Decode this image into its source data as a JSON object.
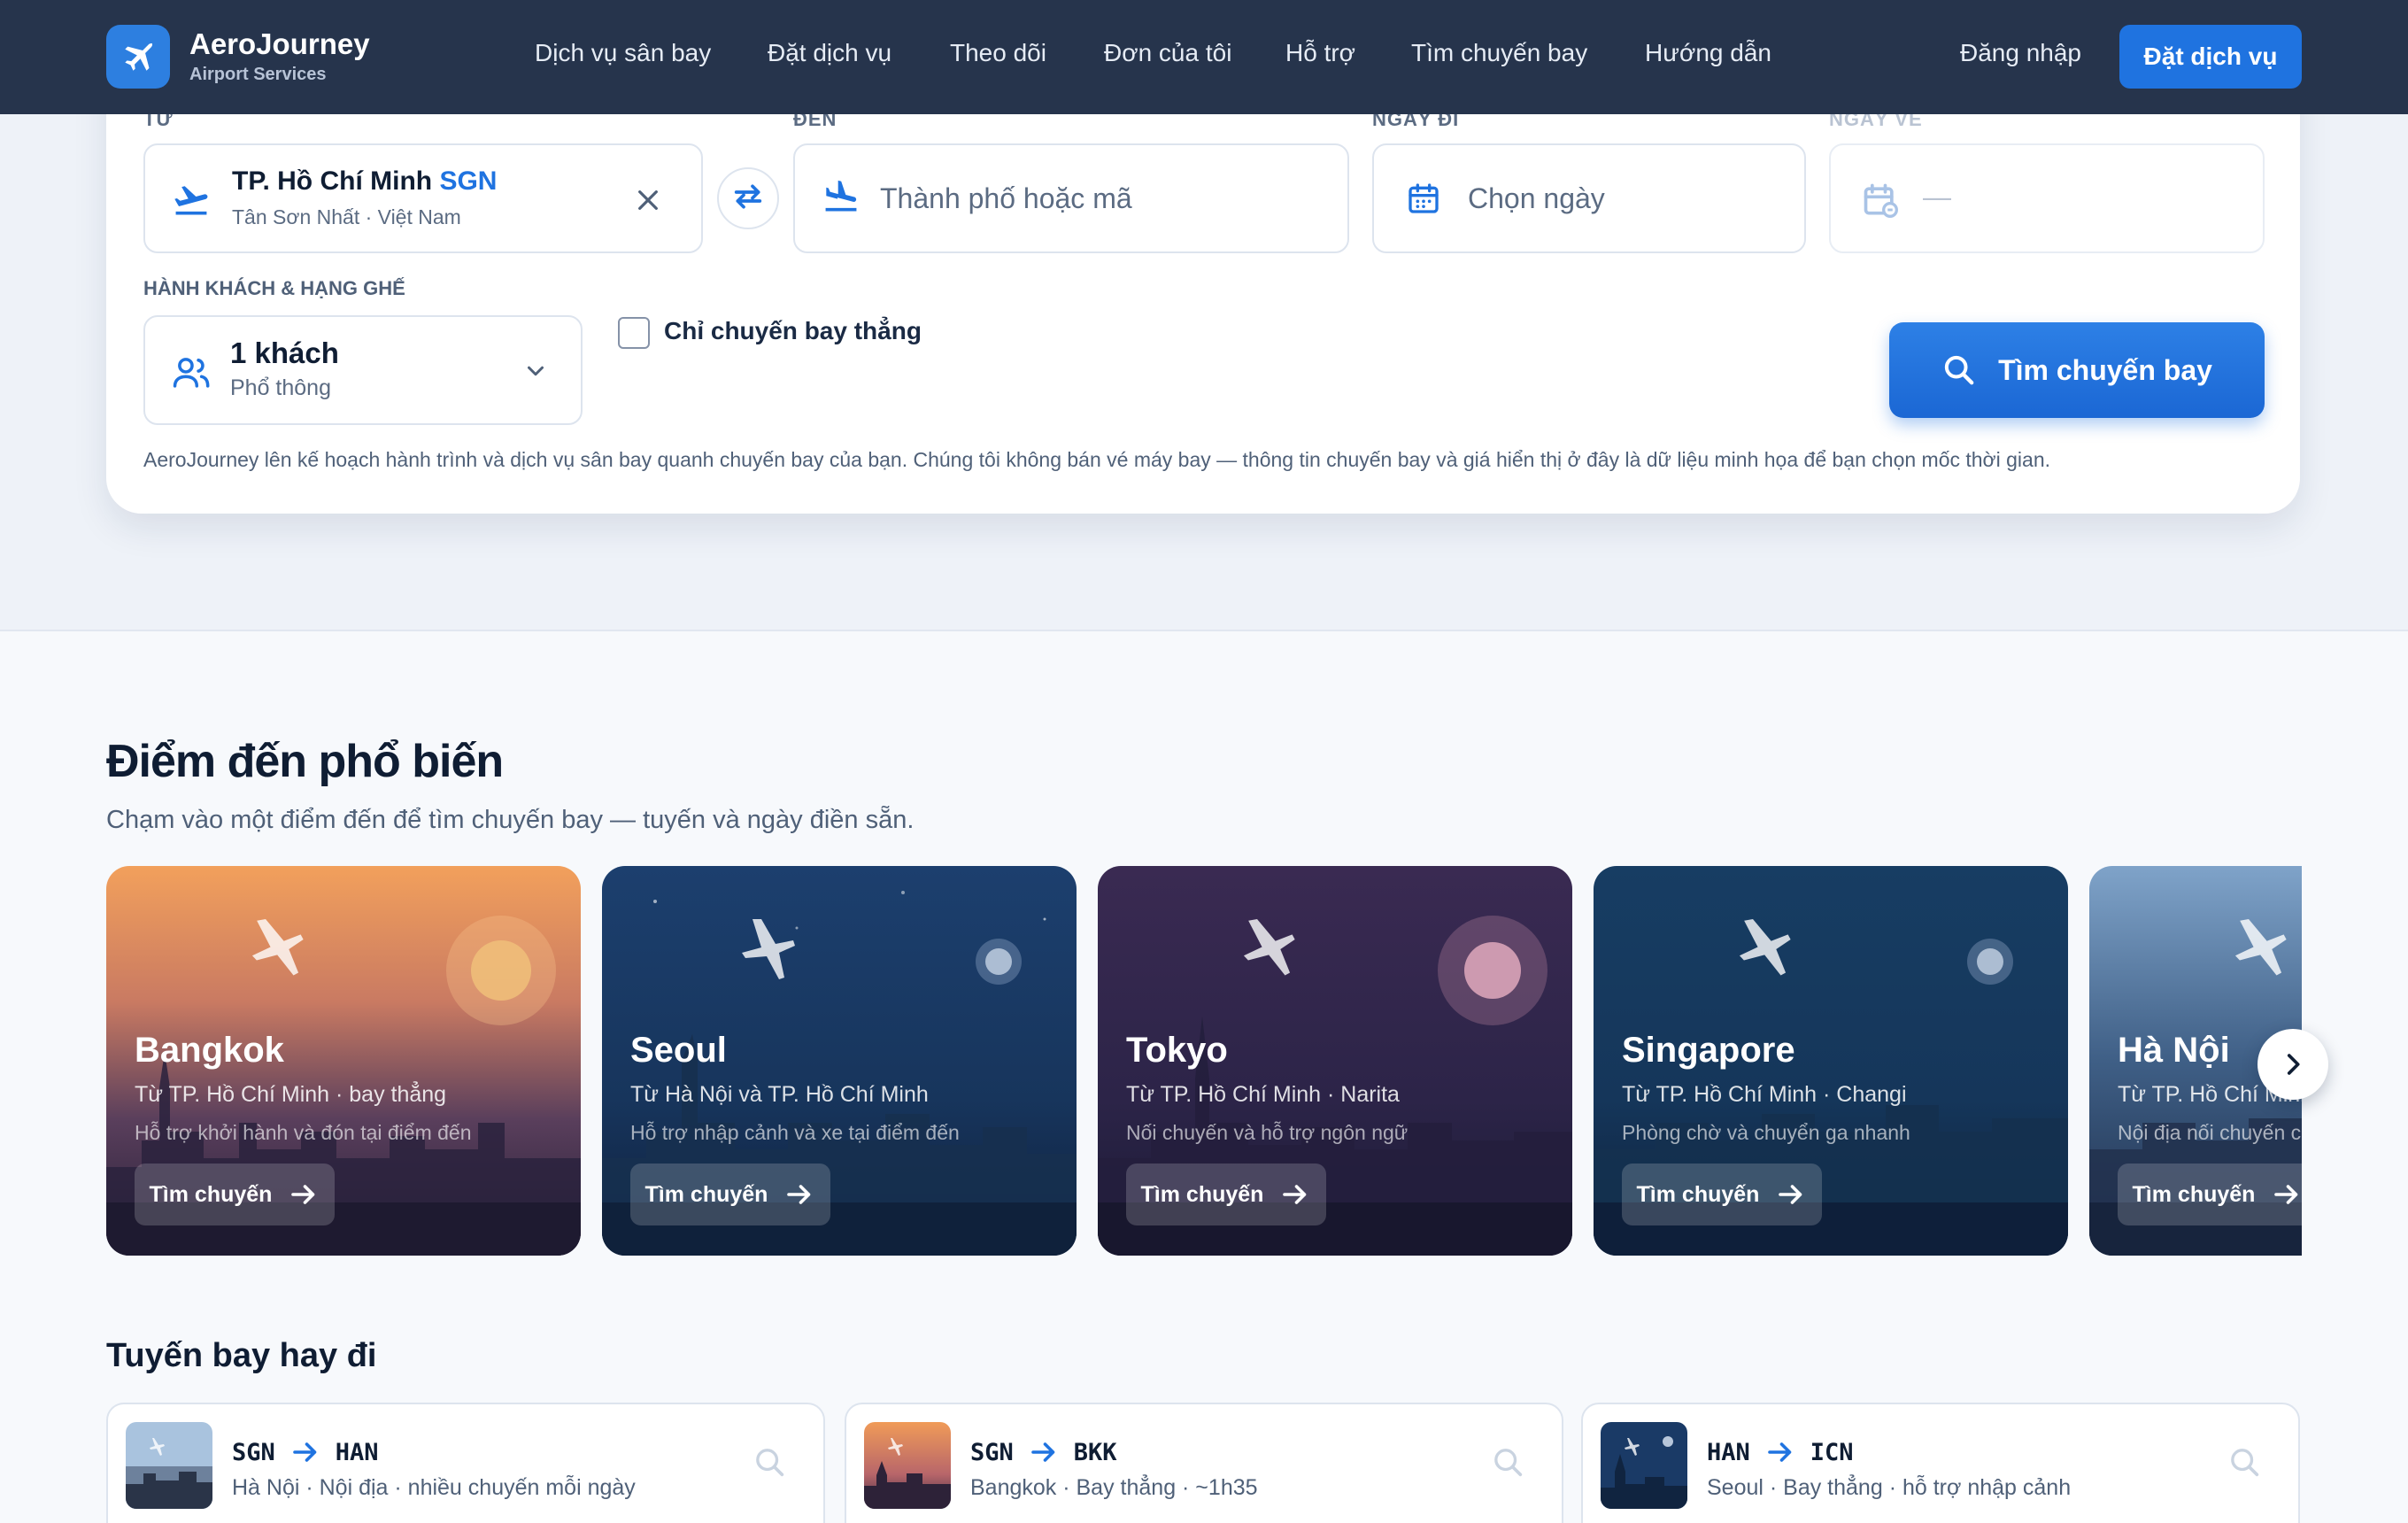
{
  "header": {
    "brand_name": "AeroJourney",
    "brand_sub": "Airport Services",
    "nav": [
      "Dịch vụ sân bay",
      "Đặt dịch vụ",
      "Theo dõi",
      "Đơn của tôi",
      "Hỗ trợ",
      "Tìm chuyến bay",
      "Hướng dẫn"
    ],
    "login": "Đăng nhập",
    "book_button": "Đặt dịch vụ"
  },
  "search": {
    "from_label": "TỪ",
    "from_city": "TP. Hồ Chí Minh",
    "from_code": "SGN",
    "from_sub": "Tân Sơn Nhất · Việt Nam",
    "to_label": "ĐẾN",
    "to_placeholder": "Thành phố hoặc mã",
    "depart_label": "NGÀY ĐI",
    "depart_placeholder": "Chọn ngày",
    "return_label": "NGÀY VỀ",
    "return_placeholder": "—",
    "passenger_label": "HÀNH KHÁCH & HẠNG GHẾ",
    "passenger_count": "1 khách",
    "cabin_class": "Phổ thông",
    "direct_only_label": "Chỉ chuyến bay thẳng",
    "direct_only_checked": false,
    "search_button": "Tìm chuyến bay",
    "disclaimer": "AeroJourney lên kế hoạch hành trình và dịch vụ sân bay quanh chuyến bay của bạn. Chúng tôi không bán vé máy bay — thông tin chuyến bay và giá hiển thị ở đây là dữ liệu minh họa để bạn chọn mốc thời gian."
  },
  "popular": {
    "title": "Điểm đến phổ biến",
    "subtitle": "Chạm vào một điểm đến để tìm chuyến bay — tuyến và ngày điền sẵn.",
    "button_label": "Tìm chuyến",
    "destinations": [
      {
        "name": "Bangkok",
        "route": "Từ TP. Hồ Chí Minh · bay thẳng",
        "desc": "Hỗ trợ khởi hành và đón tại điểm đến",
        "theme": "sunset"
      },
      {
        "name": "Seoul",
        "route": "Từ Hà Nội và TP. Hồ Chí Minh",
        "desc": "Hỗ trợ nhập cảnh và xe tại điểm đến",
        "theme": "night-blue"
      },
      {
        "name": "Tokyo",
        "route": "Từ TP. Hồ Chí Minh · Narita",
        "desc": "Nối chuyến và hỗ trợ ngôn ngữ",
        "theme": "night-purple"
      },
      {
        "name": "Singapore",
        "route": "Từ TP. Hồ Chí Minh · Changi",
        "desc": "Phòng chờ và chuyển ga nhanh",
        "theme": "night-teal"
      },
      {
        "name": "Hà Nội",
        "route": "Từ TP. Hồ Chí Minh",
        "desc": "Nội địa nối chuyến c",
        "theme": "dusk-blue"
      }
    ]
  },
  "routes": {
    "title": "Tuyến bay hay đi",
    "items": [
      {
        "from": "SGN",
        "to": "HAN",
        "sub": "Hà Nội · Nội địa · nhiều chuyến mỗi ngày",
        "theme": "day"
      },
      {
        "from": "SGN",
        "to": "BKK",
        "sub": "Bangkok · Bay thẳng · ~1h35",
        "theme": "sunset"
      },
      {
        "from": "HAN",
        "to": "ICN",
        "sub": "Seoul · Bay thẳng · hỗ trợ nhập cảnh",
        "theme": "night"
      }
    ]
  },
  "colors": {
    "header_bg": "#26344c",
    "accent": "#1f73e0",
    "text_dark": "#0f1d33",
    "text_muted": "#4f6078"
  },
  "icons": [
    "plane-logo-icon",
    "takeoff-icon",
    "clear-icon",
    "swap-icon",
    "landing-icon",
    "calendar-icon",
    "calendar-return-icon",
    "users-icon",
    "chevron-down-icon",
    "search-icon",
    "arrow-right-icon",
    "chevron-right-icon"
  ]
}
